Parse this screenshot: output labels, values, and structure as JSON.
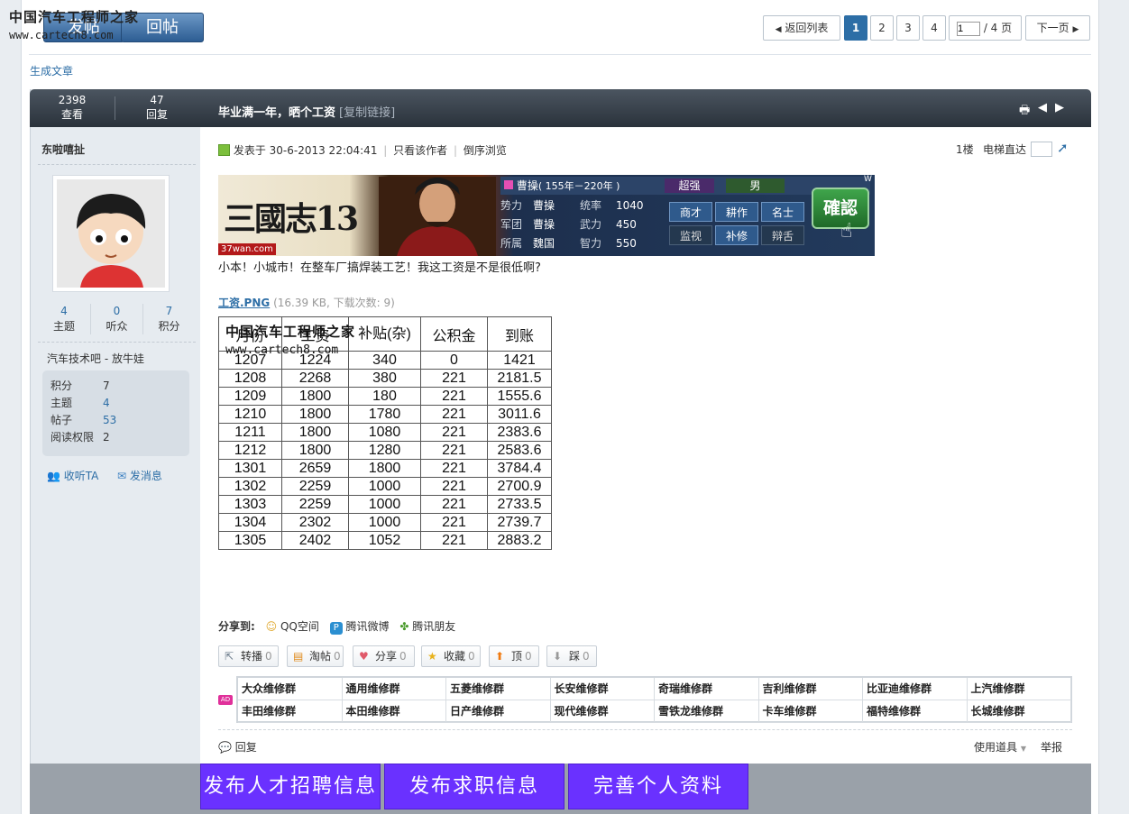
{
  "watermark": {
    "site": "中国汽车工程师之家",
    "url": "www.cartech8.com"
  },
  "toolbar": {
    "new_post": "发帖",
    "reply": "回帖"
  },
  "pagination": {
    "back": "返回列表",
    "pages": [
      "1",
      "2",
      "3",
      "4"
    ],
    "current": "1",
    "input_value": "1",
    "total": "/ 4 页",
    "next": "下一页"
  },
  "generate_article": "生成文章",
  "thread_stats": {
    "views": "2398",
    "views_label": "查看",
    "replies": "47",
    "replies_label": "回复"
  },
  "thread": {
    "title": "毕业满一年，晒个工资",
    "copy_link": "[复制链接]"
  },
  "author": {
    "name": "东啦嘻扯",
    "counts": [
      {
        "value": "4",
        "label": "主题"
      },
      {
        "value": "0",
        "label": "听众"
      },
      {
        "value": "7",
        "label": "积分"
      }
    ],
    "group": "汽车技术吧 - 放牛娃",
    "profile": [
      {
        "k": "积分",
        "v": "7"
      },
      {
        "k": "主题",
        "v": "4"
      },
      {
        "k": "帖子",
        "v": "53"
      },
      {
        "k": "阅读权限",
        "v": "2"
      }
    ],
    "follow": "收听TA",
    "message": "发消息"
  },
  "post": {
    "posted_at": "发表于 30-6-2013 22:04:41",
    "only_author": "只看该作者",
    "reverse": "倒序浏览",
    "floor": "1楼",
    "elevator": "电梯直达",
    "body": "小本！小城市！在整车厂搞焊装工艺！我这工资是不是很低啊?",
    "attachment_name": "工资.PNG",
    "attachment_meta": "(16.39 KB, 下载次数: 9)"
  },
  "ad_banner": {
    "game_title": "三國志13",
    "brand": "37wan.com",
    "character": "曹操",
    "era": "( 155年－220年 )",
    "rank": "超强",
    "gender": "男",
    "rows": [
      [
        "势力",
        "曹操",
        "统率",
        "1040"
      ],
      [
        "军团",
        "曹操",
        "武力",
        "450"
      ],
      [
        "所属",
        "魏国",
        "智力",
        "550"
      ]
    ],
    "buttons": [
      "商才",
      "耕作",
      "名士",
      "监视",
      "补修",
      "辩舌"
    ],
    "confirm": "確認",
    "corner": "W"
  },
  "wage_table": {
    "overlay_site": "中国汽车工程师之家",
    "overlay_url": "www.cartech8.com",
    "headers": [
      "月份",
      "工资",
      "补贴(杂)",
      "公积金",
      "到账"
    ],
    "rows": [
      [
        "1207",
        "1224",
        "340",
        "0",
        "1421"
      ],
      [
        "1208",
        "2268",
        "380",
        "221",
        "2181.5"
      ],
      [
        "1209",
        "1800",
        "180",
        "221",
        "1555.6"
      ],
      [
        "1210",
        "1800",
        "1780",
        "221",
        "3011.6"
      ],
      [
        "1211",
        "1800",
        "1080",
        "221",
        "2383.6"
      ],
      [
        "1212",
        "1800",
        "1280",
        "221",
        "2583.6"
      ],
      [
        "1301",
        "2659",
        "1800",
        "221",
        "3784.4"
      ],
      [
        "1302",
        "2259",
        "1000",
        "221",
        "2700.9"
      ],
      [
        "1303",
        "2259",
        "1000",
        "221",
        "2733.5"
      ],
      [
        "1304",
        "2302",
        "1000",
        "221",
        "2739.7"
      ],
      [
        "1305",
        "2402",
        "1052",
        "221",
        "2883.2"
      ]
    ]
  },
  "share": {
    "label": "分享到:",
    "items": [
      "QQ空间",
      "腾讯微博",
      "腾讯朋友"
    ]
  },
  "actions": [
    {
      "label": "转播",
      "count": "0"
    },
    {
      "label": "淘帖",
      "count": "0"
    },
    {
      "label": "分享",
      "count": "0"
    },
    {
      "label": "收藏",
      "count": "0"
    },
    {
      "label": "顶",
      "count": "0"
    },
    {
      "label": "踩",
      "count": "0"
    }
  ],
  "ad_tag": "AD",
  "repair_groups": [
    "大众维修群",
    "通用维修群",
    "五菱维修群",
    "长安维修群",
    "奇瑞维修群",
    "吉利维修群",
    "比亚迪维修群",
    "上汽维修群",
    "丰田维修群",
    "本田维修群",
    "日产维修群",
    "现代维修群",
    "雪铁龙维修群",
    "卡车维修群",
    "福特维修群",
    "长城维修群"
  ],
  "footer": {
    "reply": "回复",
    "tools": "使用道具",
    "report": "举报"
  },
  "bottom_buttons": [
    "发布人才招聘信息",
    "发布求职信息",
    "完善个人资料"
  ],
  "colors": {
    "accent": "#2d6ea6",
    "header_dark": "#2a323b",
    "promo_purple": "#6a31ff"
  }
}
